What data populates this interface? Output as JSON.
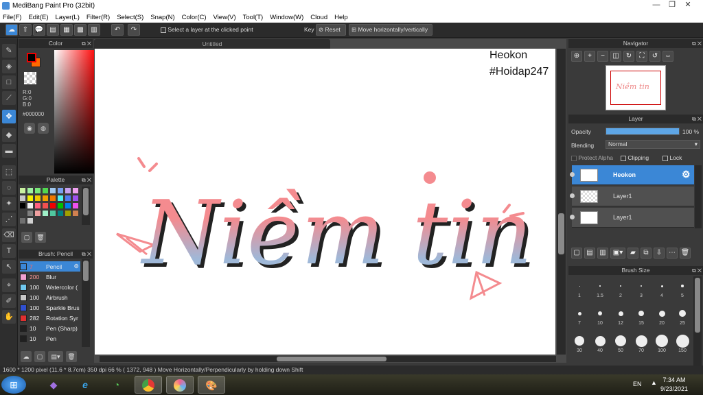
{
  "window": {
    "title": "MediBang Paint Pro (32bit)"
  },
  "menu": [
    "File(F)",
    "Edit(E)",
    "Layer(L)",
    "Filter(R)",
    "Select(S)",
    "Snap(N)",
    "Color(C)",
    "View(V)",
    "Tool(T)",
    "Window(W)",
    "Cloud",
    "Help"
  ],
  "toolbar": {
    "select_layer_label": "Select a layer at the clicked point",
    "key_label": "Key",
    "reset_label": "Reset",
    "move_label": "Move horizontally/vertically"
  },
  "color_panel": {
    "title": "Color",
    "r": "R:0",
    "g": "G:0",
    "b": "B:0",
    "hex": "#000000",
    "primary": "#000000",
    "secondary": "#ff6a00"
  },
  "palette_panel": {
    "title": "Palette",
    "colors": [
      "#c8f0a0",
      "#a0f0a0",
      "#78e878",
      "#50d850",
      "#a0c8f0",
      "#78a0f0",
      "#c8a0f0",
      "#f0a0f0",
      "#c8c8c8",
      "#f0f000",
      "#f0c800",
      "#f0a000",
      "#f07800",
      "#50f0f0",
      "#5078f0",
      "#a050f0",
      "#000000",
      "#f0f0f0",
      "#ff6080",
      "#f05050",
      "#f00000",
      "#00c000",
      "#0080f0",
      "#f050f0",
      "#3c3c3c",
      "#808080",
      "#f0a0a0",
      "#a0f0c8",
      "#50c8a0",
      "#008080",
      "#a0a000",
      "#d08050",
      "#707070",
      "#d0d0d0"
    ]
  },
  "brush_panel": {
    "title": "Brush: Pencil",
    "items": [
      {
        "size": "7",
        "name": "Pencil",
        "color": "#3b87d6",
        "selected": true
      },
      {
        "size": "200",
        "name": "Blur",
        "color": "#f0a0d0"
      },
      {
        "size": "100",
        "name": "Watercolor (",
        "color": "#70c8f0"
      },
      {
        "size": "100",
        "name": "Airbrush",
        "color": "#c8c8c8"
      },
      {
        "size": "100",
        "name": "Sparkle Brus",
        "color": "#3050d0"
      },
      {
        "size": "282",
        "name": "Rotation Syr",
        "color": "#e03030"
      },
      {
        "size": "10",
        "name": "Pen (Sharp)",
        "color": "#202020"
      },
      {
        "size": "10",
        "name": "Pen",
        "color": "#202020"
      }
    ]
  },
  "document": {
    "tab": "Untitled",
    "watermark_line1": "Heokon",
    "watermark_line2": "#Hoidap247",
    "artwork_text": "Niềm tin"
  },
  "navigator": {
    "title": "Navigator",
    "thumb_text": "Niềm tin"
  },
  "layer_panel": {
    "title": "Layer",
    "opacity_label": "Opacity",
    "opacity_value": "100 %",
    "opacity_fraction": 1.0,
    "blending_label": "Blending",
    "blending_value": "Normal",
    "protect_alpha": "Protect Alpha",
    "clipping": "Clipping",
    "lock": "Lock",
    "layers": [
      {
        "name": "Heokon",
        "selected": true
      },
      {
        "name": "Layer1"
      },
      {
        "name": "Layer1"
      }
    ]
  },
  "brush_size_panel": {
    "title": "Brush Size",
    "sizes": [
      "1",
      "1.5",
      "2",
      "3",
      "4",
      "5",
      "7",
      "10",
      "12",
      "15",
      "20",
      "25",
      "30",
      "40",
      "50",
      "70",
      "100",
      "150"
    ]
  },
  "status": {
    "text": "1600 * 1200 pixel  (11.6 * 8.7cm)  350 dpi  66 %  ( 1372, 948 )  Move Horizontally/Perpendicularly by holding down Shift"
  },
  "taskbar": {
    "lang": "EN",
    "time": "7:34 AM",
    "date": "9/23/2021"
  }
}
